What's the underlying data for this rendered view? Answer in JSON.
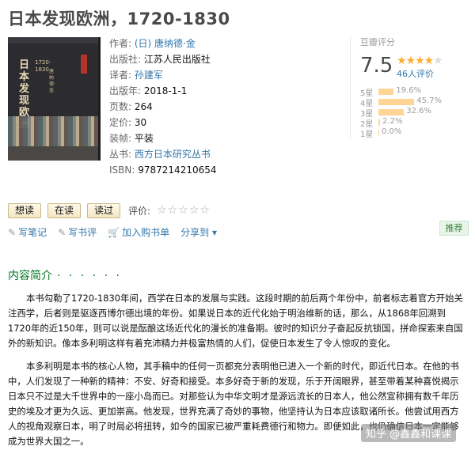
{
  "title": "日本发现欧洲，1720-1830",
  "cover": {
    "vertical_title": "日本发现欧洲",
    "vertical_subtitle": "1720-1830",
    "vertical_author": "唐纳德·金"
  },
  "meta": [
    {
      "label": "作者:",
      "value": "(日) 唐纳德·金",
      "link": true
    },
    {
      "label": "出版社:",
      "value": "江苏人民出版社",
      "link": false
    },
    {
      "label": "译者:",
      "value": "孙建军",
      "link": true
    },
    {
      "label": "出版年:",
      "value": "2018-1-1",
      "link": false
    },
    {
      "label": "页数:",
      "value": "264",
      "link": false
    },
    {
      "label": "定价:",
      "value": "30",
      "link": false
    },
    {
      "label": "装帧:",
      "value": "平装",
      "link": false
    },
    {
      "label": "丛书:",
      "value": "西方日本研究丛书",
      "link": true
    },
    {
      "label": "ISBN:",
      "value": "9787214210654",
      "link": false
    }
  ],
  "rating": {
    "title": "豆瓣评分",
    "score": "7.5",
    "stars_filled": 4,
    "stars_total": 5,
    "count": "46人评价",
    "bars": [
      {
        "label": "5星",
        "percent_text": "19.6%",
        "percent": 19.6
      },
      {
        "label": "4星",
        "percent_text": "45.7%",
        "percent": 45.7
      },
      {
        "label": "3星",
        "percent_text": "32.6%",
        "percent": 32.6
      },
      {
        "label": "2星",
        "percent_text": "2.2%",
        "percent": 2.2
      },
      {
        "label": "1星",
        "percent_text": "0.0%",
        "percent": 0.0
      }
    ],
    "bar_color": "#ffd596",
    "star_color": "#ffac2d"
  },
  "actions": {
    "want": "想读",
    "reading": "在读",
    "read": "读过",
    "rate_label": "评价:",
    "rate_stars": "☆☆☆☆☆"
  },
  "links": {
    "note": "写笔记",
    "review": "写书评",
    "cart": "加入购书单",
    "share": "分享到 ▾",
    "recommend": "推荐"
  },
  "section": {
    "title": "内容简介",
    "dots": "· · · · · ·"
  },
  "intro": [
    "本书勾勒了1720-1830年间，西学在日本的发展与实践。这段时期的前后两个年份中，前者标志着官方开始关注西学，后者则是驱逐西博尔德出境的年份。如果说日本的近代化始于明治维新的话，那么，从1868年回溯到1720年的近150年，则可以说是酝酿这场近代化的漫长的准备期。彼时的知识分子奋起反抗锁国，拼命探索来自国外的新知识。像本多利明这样有着充沛精力并极富热情的人们，促使日本发生了令人惊叹的变化。",
    "本多利明是本书的核心人物，其手稿中的任何一页都充分表明他已进入一个新的时代，即近代日本。在他的书中，人们发现了一种新的精神：不安、好奇和接受。本多好奇于新的发现，乐于开阔眼界，甚至带着某种喜悦揭示日本只不过是大千世界中的一座小岛而已。对那些认为中华文明才是源远流长的日本人，他公然宣称拥有数千年历史的埃及才更为久远、更加崇高。他发现，世界充满了奇妙的事物，他坚持认为日本应该取诸所长。他尝试用西方人的视角观察日本，明了时局必将扭转，如今的国家已被严重耗费德行和物力。即便如此，也仍确信日本一定能够成为世界大国之一。"
  ],
  "watermark": "知乎 @鑫鑫和课课"
}
